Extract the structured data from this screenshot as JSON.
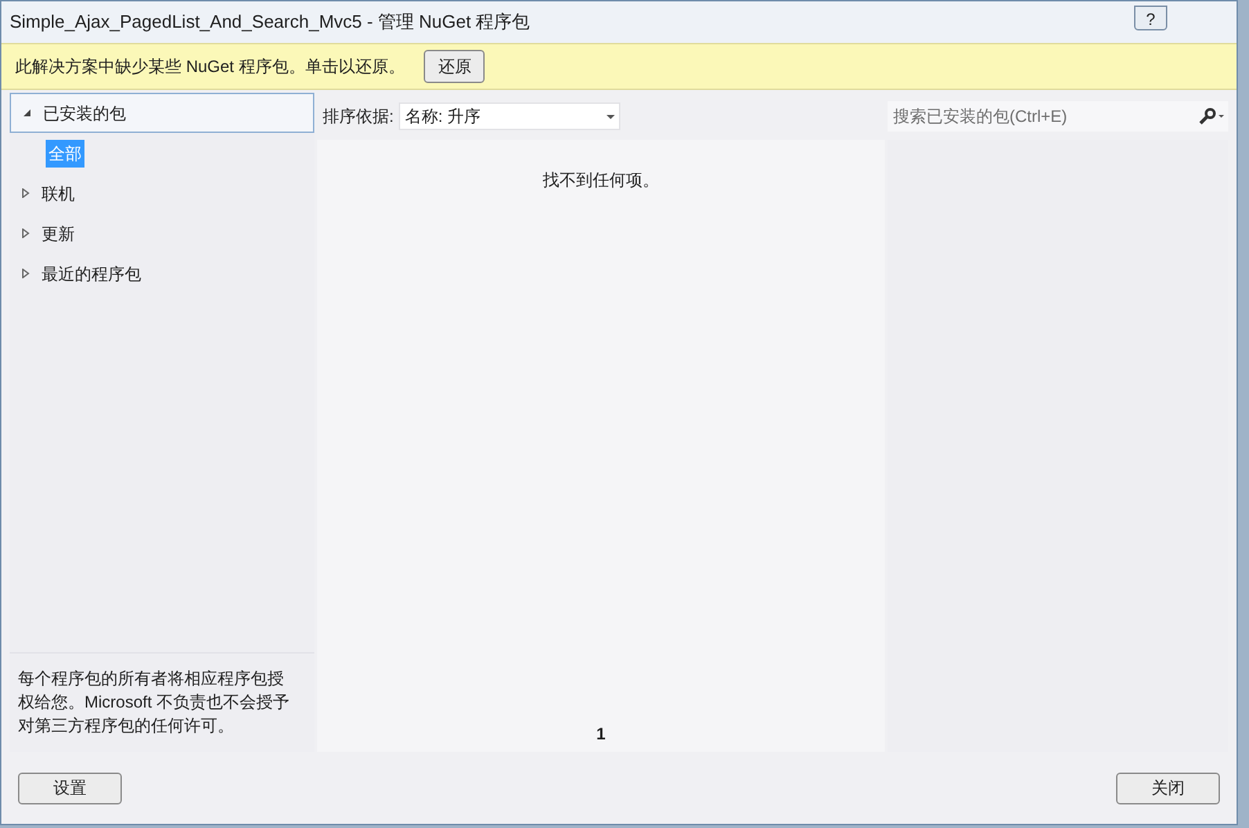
{
  "window": {
    "title": "Simple_Ajax_PagedList_And_Search_Mvc5 - 管理 NuGet 程序包",
    "help": "?"
  },
  "notice": {
    "text": "此解决方案中缺少某些 NuGet 程序包。单击以还原。",
    "button": "还原"
  },
  "sidebar": {
    "items": [
      {
        "label": "已安装的包",
        "expanded": true,
        "selected": false,
        "children": [
          {
            "label": "全部",
            "selected": true
          }
        ]
      },
      {
        "label": "联机",
        "expanded": false,
        "selected": false
      },
      {
        "label": "更新",
        "expanded": false,
        "selected": false
      },
      {
        "label": "最近的程序包",
        "expanded": false,
        "selected": false
      }
    ],
    "footer": "每个程序包的所有者将相应程序包授权给您。Microsoft 不负责也不会授予对第三方程序包的任何许可。"
  },
  "sort": {
    "label": "排序依据:",
    "value": "名称: 升序"
  },
  "results": {
    "empty_message": "找不到任何项。",
    "page": "1"
  },
  "search": {
    "placeholder": "搜索已安装的包(Ctrl+E)"
  },
  "buttons": {
    "settings": "设置",
    "close": "关闭"
  }
}
